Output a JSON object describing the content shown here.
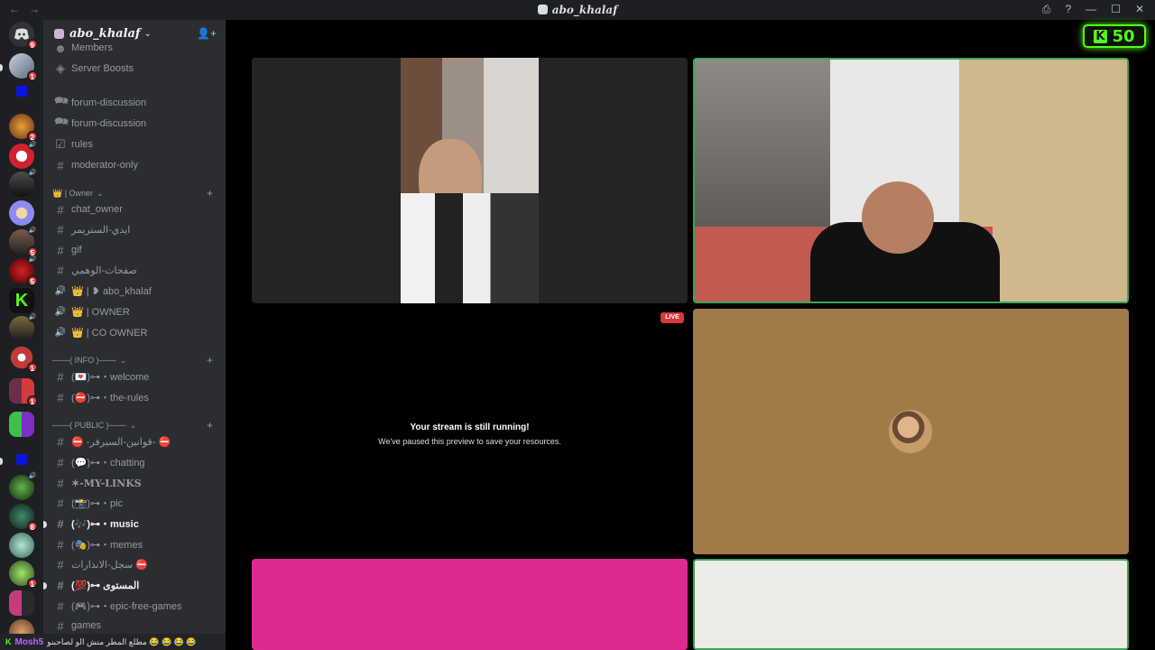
{
  "window": {
    "title": "abo_khalaf",
    "nav_back": "←",
    "nav_fwd": "→",
    "controls": [
      "⎙",
      "?",
      "—",
      "☐",
      "✕"
    ]
  },
  "rail": {
    "discord_badge": "9",
    "servers": [
      {
        "badge": "1"
      },
      {
        "badge": ""
      },
      {
        "badge": "2"
      },
      {
        "badge": ""
      },
      {
        "badge": ""
      },
      {
        "badge": ""
      },
      {
        "badge": "5"
      },
      {
        "badge": "5"
      },
      {
        "badge": ""
      },
      {
        "badge": ""
      },
      {
        "badge": "1"
      },
      {
        "badge": "1"
      },
      {
        "badge": ""
      },
      {
        "badge": ""
      },
      {
        "badge": ""
      },
      {
        "badge": "8"
      },
      {
        "badge": ""
      },
      {
        "badge": "1"
      },
      {
        "badge": ""
      },
      {
        "badge": "2"
      }
    ]
  },
  "guild": {
    "name": "abo_khalaf",
    "invite_icon": "add-member-icon"
  },
  "channels": {
    "members": "Members",
    "server_boosts": "Server Boosts",
    "forum1": "forum-discussion",
    "forum2": "forum-discussion",
    "rules": "rules",
    "moderator": "moderator-only",
    "cat_owner": "👑 | Owner",
    "chat_owner": "chat_owner",
    "arabic1": "ايدي-الستريمر",
    "gif": "gif",
    "arabic2": "صفحات-الوهمي",
    "voice1": "👑 | ❥ abo_khalaf",
    "voice2": "👑 | OWNER",
    "voice3": "👑 | CO OWNER",
    "cat_info": "───( INFO )───",
    "welcome": "(💌)⊶・welcome",
    "the_rules": "(⛔)⊶・the-rules",
    "cat_public": "───( PUBLIC )───",
    "arabic3": "⛔ -قوانين-السيرفر- ⛔",
    "chatting": "(💬)⊶・chatting",
    "mylinks": "✶-MY-LINKS",
    "pic": "(📸)⊶・pic",
    "music": "(🎶)⊶・music",
    "memes": "(🎭)⊶・memes",
    "arabic4": "سجل-الانذارات ⛔",
    "arabic5": "(💯)⊶ المستوى",
    "epic": "(🎮)⊶・epic-free-games",
    "games": "games"
  },
  "bottom": {
    "user": "Mosh5",
    "message": "مطلع المطر منش الو لصاحبنو 😂 😂 😂 😂"
  },
  "stage": {
    "kick_label": "K",
    "kick_count": "50",
    "live_badge": "LIVE",
    "stream_title": "Your stream is still running!",
    "stream_sub": "We've paused this preview to save your resources."
  },
  "colors": {
    "accent_kick": "#53fc18",
    "speaking_border": "#3ba55d",
    "live_red": "#da373c",
    "tile_brown": "#a07b48",
    "tile_pink": "#dd2a92",
    "tile_light": "#ecebe6"
  }
}
